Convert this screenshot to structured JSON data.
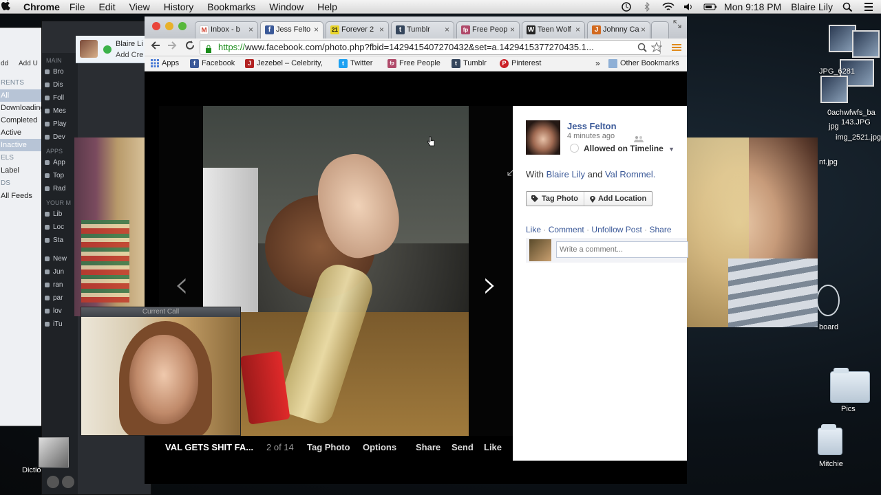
{
  "menubar": {
    "app": "Chrome",
    "items": [
      "File",
      "Edit",
      "View",
      "History",
      "Bookmarks",
      "Window",
      "Help"
    ],
    "clock": "Mon 9:18 PM",
    "user": "Blaire Lily"
  },
  "torrent": {
    "add_label": "Add U",
    "left_label": "dd",
    "sections": [
      "RENTS",
      "ELS",
      "DS"
    ],
    "rows": [
      "All",
      "Downloading",
      "Completed",
      "Active",
      "Inactive",
      "Label",
      "All Feeds"
    ]
  },
  "itunes": {
    "sections": [
      "MAIN",
      "APPS",
      "YOUR M"
    ],
    "rows": [
      "Bro",
      "Dis",
      "Foll",
      "Mes",
      "Play",
      "Dev",
      "App",
      "Top",
      "Rad",
      "Lib",
      "Loc",
      "Sta",
      "New",
      "Jun",
      "ran",
      "par",
      "lov",
      "iTu"
    ],
    "new_label": "New"
  },
  "skype": {
    "name": "Blaire Li",
    "sub": "Add Cre",
    "current_call": "Current Call"
  },
  "desktop": {
    "labels": [
      "JPG_6281",
      "0achwfwfs_ba",
      "143.JPG",
      "jpg",
      "img_2521.jpg",
      "nt.jpg",
      "board",
      "Pics",
      "Mitchie",
      "Dictio"
    ]
  },
  "chrome": {
    "tabs": [
      {
        "label": "Inbox - b",
        "icon": "gmail-icon",
        "color": "#d14836",
        "glyph": "M"
      },
      {
        "label": "Jess Felto",
        "icon": "facebook-icon",
        "color": "#3b5998",
        "glyph": "f",
        "active": true
      },
      {
        "label": "Forever 2",
        "icon": "forever21-icon",
        "color": "#e8d42a",
        "glyph": "21"
      },
      {
        "label": "Tumblr",
        "icon": "tumblr-icon",
        "color": "#35465c",
        "glyph": "t"
      },
      {
        "label": "Free Peop",
        "icon": "freepeople-icon",
        "color": "#b04a6a",
        "glyph": "fp"
      },
      {
        "label": "Teen Wolf",
        "icon": "teenwolf-icon",
        "color": "#222222",
        "glyph": "W"
      },
      {
        "label": "Johnny Ca",
        "icon": "johnnycarson-icon",
        "color": "#d2691e",
        "glyph": "J"
      }
    ],
    "url_https": "https://",
    "url_rest": "www.facebook.com/photo.php?fbid=1429415407270432&set=a.1429415377270435.1...",
    "bookmarks": [
      {
        "label": "Apps",
        "icon": "apps-icon",
        "color": "#4a7bd6",
        "glyph": "⋮"
      },
      {
        "label": "Facebook",
        "icon": "facebook-icon",
        "color": "#3b5998",
        "glyph": "f"
      },
      {
        "label": "Jezebel – Celebrity, ",
        "icon": "jezebel-icon",
        "color": "#b22222",
        "glyph": "J"
      },
      {
        "label": "Twitter",
        "icon": "twitter-icon",
        "color": "#1da1f2",
        "glyph": "t"
      },
      {
        "label": "Free People",
        "icon": "freepeople-icon",
        "color": "#b04a6a",
        "glyph": "fp"
      },
      {
        "label": "Tumblr",
        "icon": "tumblr-icon",
        "color": "#35465c",
        "glyph": "t"
      },
      {
        "label": "Pinterest",
        "icon": "pinterest-icon",
        "color": "#cb2027",
        "glyph": "P"
      }
    ],
    "more": "»",
    "other_bookmarks": "Other Bookmarks"
  },
  "photo": {
    "caption": "VAL GETS SHIT FA...",
    "counter": "2 of 14",
    "tag_photo": "Tag Photo",
    "options": "Options",
    "share": "Share",
    "send": "Send",
    "like": "Like"
  },
  "post": {
    "author": "Jess Felton",
    "time": "4 minutes ago",
    "timeline": "Allowed on Timeline",
    "with_prefix": "With",
    "with_1": "Blaire Lily",
    "with_and": "and",
    "with_2": "Val Rommel.",
    "tag_photo": "Tag Photo",
    "add_location": "Add Location",
    "like": "Like",
    "comment": "Comment",
    "unfollow": "Unfollow Post",
    "share": "Share",
    "comment_placeholder": "Write a comment..."
  },
  "colors": {
    "fb_blue": "#3b5998",
    "https_green": "#1a8c1a"
  }
}
